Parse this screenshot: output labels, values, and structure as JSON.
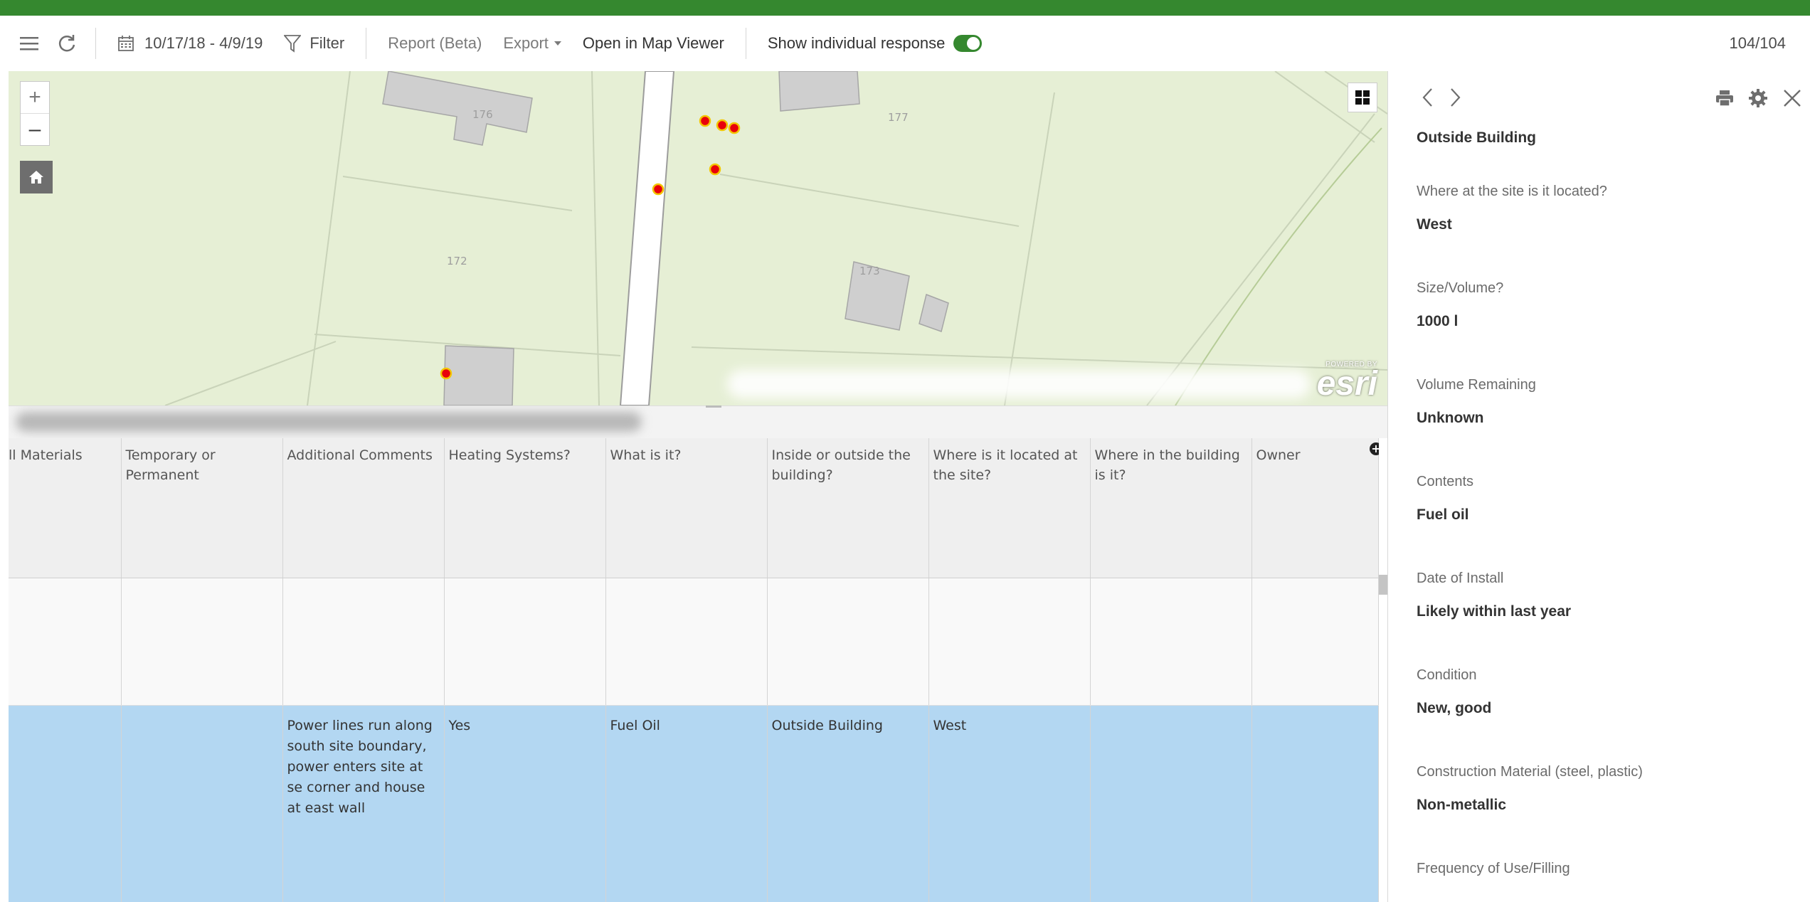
{
  "toolbar": {
    "date_range": "10/17/18 - 4/9/19",
    "filter_label": "Filter",
    "report_label": "Report (Beta)",
    "export_label": "Export",
    "open_map_label": "Open in Map Viewer",
    "show_individual_label": "Show individual response",
    "show_individual_on": true,
    "record_count": "104/104"
  },
  "map": {
    "parcel_labels": [
      "176",
      "177",
      "172",
      "173"
    ],
    "attribution": {
      "powered_by": "POWERED BY",
      "brand": "esri"
    },
    "point_color": "#e8010b",
    "land_color": "#e6efd5",
    "building_color": "#cfcfcf"
  },
  "table": {
    "columns": [
      "ll Materials",
      "Temporary or Permanent",
      "Additional Comments",
      "Heating Systems?",
      "What is it?",
      "Inside or outside the building?",
      "Where is it located at the site?",
      "Where in the building is it?",
      "Owner"
    ],
    "rows": [
      [
        "",
        "",
        "",
        "",
        "",
        "",
        "",
        "",
        ""
      ],
      [
        "",
        "",
        "Power lines run along south site boundary, power enters site at se corner and house at east wall",
        "Yes",
        "Fuel Oil",
        "Outside Building",
        "West",
        "",
        ""
      ]
    ],
    "selected_row_color": "#b3d7f2"
  },
  "panel": {
    "first_value": "Outside Building",
    "fields": [
      {
        "q": "Where at the site is it located?",
        "a": "West"
      },
      {
        "q": "Size/Volume?",
        "a": "1000 l"
      },
      {
        "q": "Volume Remaining",
        "a": "Unknown"
      },
      {
        "q": "Contents",
        "a": "Fuel oil"
      },
      {
        "q": "Date of Install",
        "a": "Likely within last year"
      },
      {
        "q": "Condition",
        "a": "New, good"
      },
      {
        "q": "Construction Material (steel, plastic)",
        "a": "Non-metallic"
      },
      {
        "q": "Frequency of Use/Filling",
        "a": ""
      }
    ]
  },
  "colors": {
    "accent": "#35882f"
  }
}
